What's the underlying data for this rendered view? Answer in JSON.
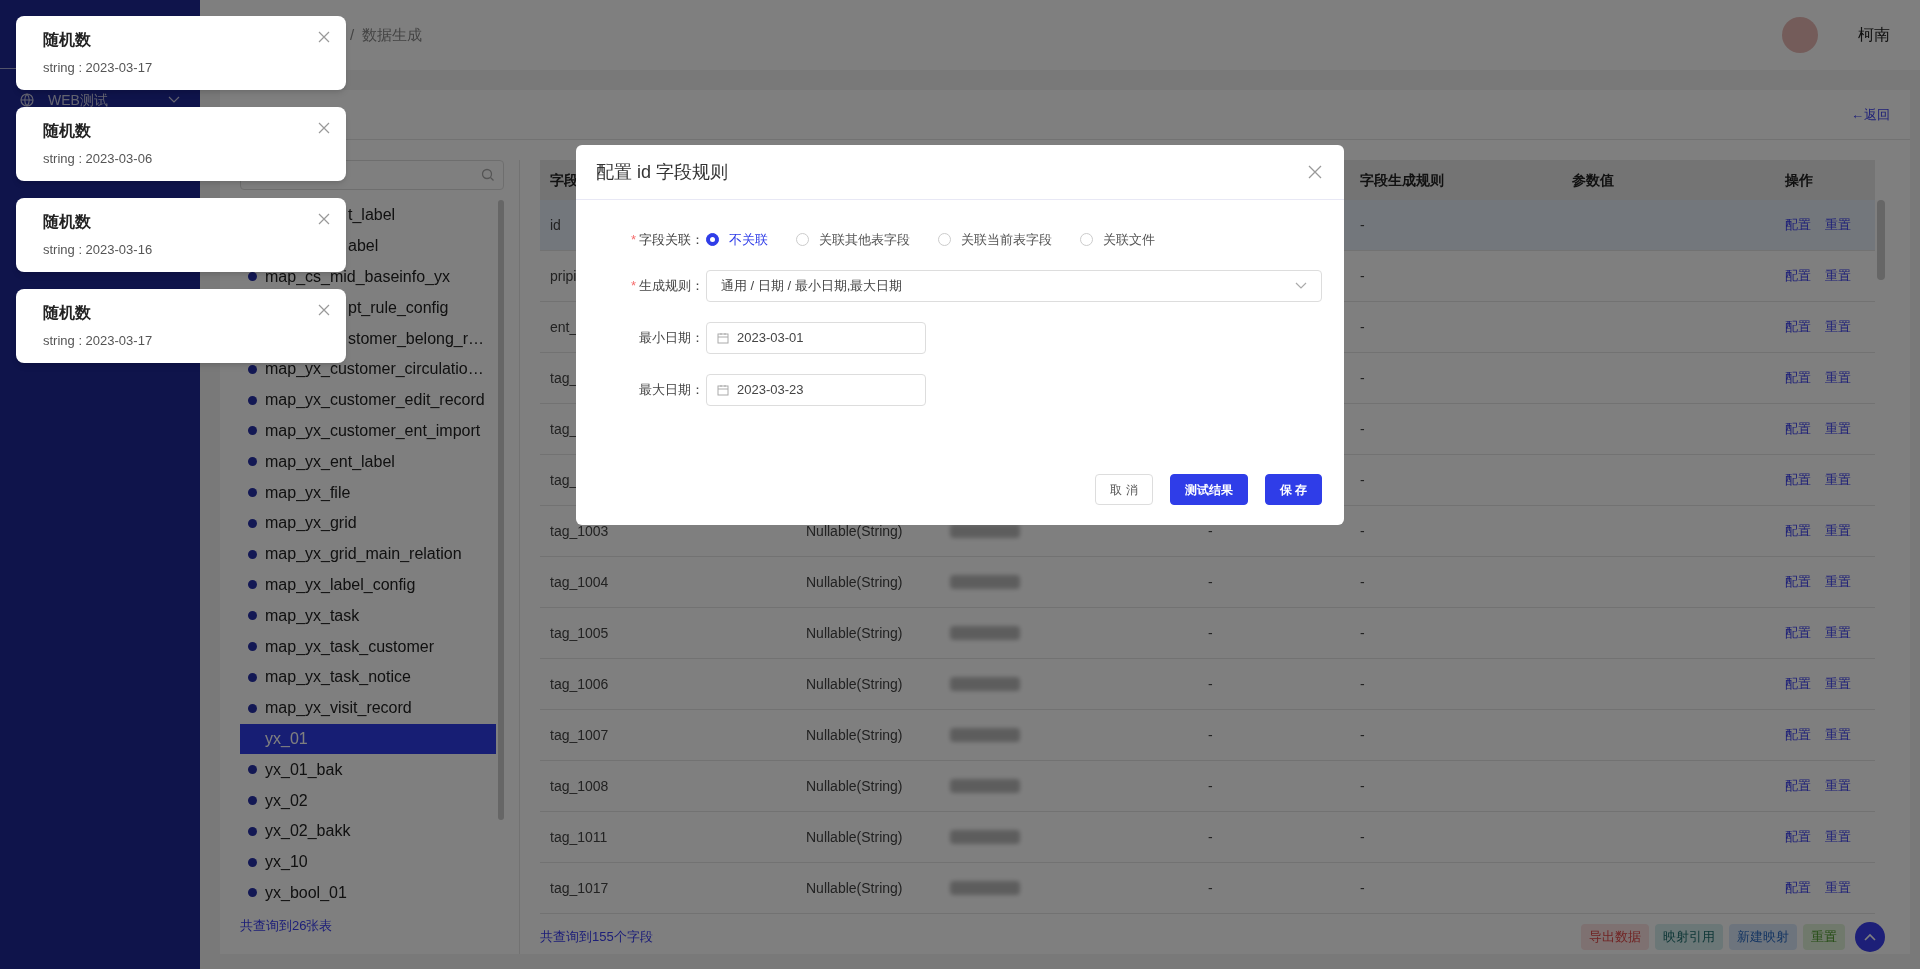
{
  "sidebar": {
    "items": [
      {
        "label": "WEB测试",
        "expanded": false
      }
    ]
  },
  "header": {
    "breadcrumb": {
      "separator": "/",
      "current": "数据生成"
    },
    "user": {
      "name": "柯南"
    }
  },
  "page": {
    "back_link": "←返回"
  },
  "table_list": {
    "items": [
      {
        "label": "t_label",
        "kind": "cut",
        "selected": false
      },
      {
        "label": "abel",
        "kind": "cut",
        "selected": false
      },
      {
        "label": "map_cs_mid_baseinfo_yx",
        "kind": "plain",
        "selected": false
      },
      {
        "label": "pt_rule_config",
        "kind": "cut",
        "selected": false
      },
      {
        "label": "stomer_belong_r…",
        "kind": "cut",
        "selected": false
      },
      {
        "label": "map_yx_customer_circulatio…",
        "kind": "plain",
        "selected": false
      },
      {
        "label": "map_yx_customer_edit_record",
        "kind": "plain",
        "selected": false
      },
      {
        "label": "map_yx_customer_ent_import",
        "kind": "plain",
        "selected": false
      },
      {
        "label": "map_yx_ent_label",
        "kind": "plain",
        "selected": false
      },
      {
        "label": "map_yx_file",
        "kind": "plain",
        "selected": false
      },
      {
        "label": "map_yx_grid",
        "kind": "plain",
        "selected": false
      },
      {
        "label": "map_yx_grid_main_relation",
        "kind": "plain",
        "selected": false
      },
      {
        "label": "map_yx_label_config",
        "kind": "plain",
        "selected": false
      },
      {
        "label": "map_yx_task",
        "kind": "plain",
        "selected": false
      },
      {
        "label": "map_yx_task_customer",
        "kind": "plain",
        "selected": false
      },
      {
        "label": "map_yx_task_notice",
        "kind": "plain",
        "selected": false
      },
      {
        "label": "map_yx_visit_record",
        "kind": "plain",
        "selected": false
      },
      {
        "label": "yx_01",
        "kind": "plain",
        "selected": true
      },
      {
        "label": "yx_01_bak",
        "kind": "plain",
        "selected": false
      },
      {
        "label": "yx_02",
        "kind": "plain",
        "selected": false
      },
      {
        "label": "yx_02_bakk",
        "kind": "plain",
        "selected": false
      },
      {
        "label": "yx_10",
        "kind": "plain",
        "selected": false
      },
      {
        "label": "yx_bool_01",
        "kind": "plain",
        "selected": false
      }
    ],
    "footer": "共查询到26张表"
  },
  "table": {
    "header": {
      "column_1": "字段",
      "column_5": "字段生成规则",
      "column_6": "参数值",
      "column_7": "操作"
    },
    "rows": [
      {
        "column_1": "id",
        "column_5": "-",
        "actions": [
          "配置",
          "重置"
        ],
        "selected": true
      },
      {
        "column_1": "pripi",
        "column_5": "-",
        "actions": [
          "配置",
          "重置"
        ],
        "selected": false
      },
      {
        "column_1": "ent_",
        "column_5": "-",
        "actions": [
          "配置",
          "重置"
        ],
        "selected": false
      },
      {
        "column_1": "tag_",
        "column_5": "-",
        "actions": [
          "配置",
          "重置"
        ],
        "selected": false
      },
      {
        "column_1": "tag_",
        "column_5": "-",
        "actions": [
          "配置",
          "重置"
        ],
        "selected": false
      },
      {
        "column_1": "tag_",
        "column_5": "-",
        "actions": [
          "配置",
          "重置"
        ],
        "selected": false
      },
      {
        "column_1": "tag_1003",
        "column_2": "Nullable(String)",
        "column_4": "-",
        "column_5": "-",
        "actions": [
          "配置",
          "重置"
        ],
        "selected": false
      },
      {
        "column_1": "tag_1004",
        "column_2": "Nullable(String)",
        "column_4": "-",
        "column_5": "-",
        "actions": [
          "配置",
          "重置"
        ],
        "selected": false
      },
      {
        "column_1": "tag_1005",
        "column_2": "Nullable(String)",
        "column_4": "-",
        "column_5": "-",
        "actions": [
          "配置",
          "重置"
        ],
        "selected": false
      },
      {
        "column_1": "tag_1006",
        "column_2": "Nullable(String)",
        "column_4": "-",
        "column_5": "-",
        "actions": [
          "配置",
          "重置"
        ],
        "selected": false
      },
      {
        "column_1": "tag_1007",
        "column_2": "Nullable(String)",
        "column_4": "-",
        "column_5": "-",
        "actions": [
          "配置",
          "重置"
        ],
        "selected": false
      },
      {
        "column_1": "tag_1008",
        "column_2": "Nullable(String)",
        "column_4": "-",
        "column_5": "-",
        "actions": [
          "配置",
          "重置"
        ],
        "selected": false
      },
      {
        "column_1": "tag_1011",
        "column_2": "Nullable(String)",
        "column_4": "-",
        "column_5": "-",
        "actions": [
          "配置",
          "重置"
        ],
        "selected": false
      },
      {
        "column_1": "tag_1017",
        "column_2": "Nullable(String)",
        "column_4": "-",
        "column_5": "-",
        "actions": [
          "配置",
          "重置"
        ],
        "selected": false
      }
    ],
    "footer": "共查询到155个字段",
    "buttons": [
      {
        "label": "导出数据",
        "kind": "danger"
      },
      {
        "label": "映射引用",
        "kind": "teal"
      },
      {
        "label": "新建映射",
        "kind": "info"
      },
      {
        "label": "重置",
        "kind": "success"
      }
    ]
  },
  "dialog": {
    "title": "配置 id 字段规则",
    "relation": {
      "label": "字段关联：",
      "required_mark": "*",
      "options": [
        {
          "label": "不关联",
          "selected": true
        },
        {
          "label": "关联其他表字段",
          "selected": false
        },
        {
          "label": "关联当前表字段",
          "selected": false
        },
        {
          "label": "关联文件",
          "selected": false
        }
      ]
    },
    "rule": {
      "label": "生成规则：",
      "required_mark": "*",
      "value": "通用 / 日期 / 最小日期,最大日期"
    },
    "min_date": {
      "label": "最小日期：",
      "value": "2023-03-01"
    },
    "max_date": {
      "label": "最大日期：",
      "value": "2023-03-23"
    },
    "buttons": [
      {
        "label": "取 消",
        "kind": "default"
      },
      {
        "label": "测试结果",
        "kind": "primary"
      },
      {
        "label": "保 存",
        "kind": "primary"
      }
    ]
  },
  "notifications": [
    {
      "title": "随机数",
      "message": "string : 2023-03-17"
    },
    {
      "title": "随机数",
      "message": "string : 2023-03-06"
    },
    {
      "title": "随机数",
      "message": "string : 2023-03-16"
    },
    {
      "title": "随机数",
      "message": "string : 2023-03-17"
    }
  ]
}
